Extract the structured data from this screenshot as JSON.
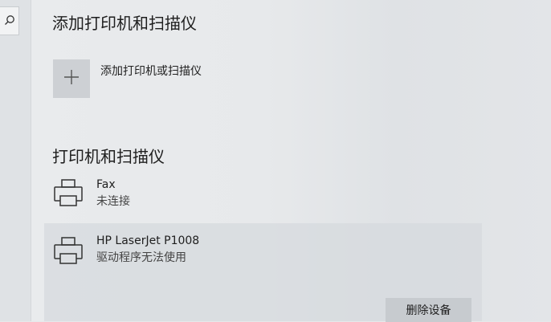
{
  "sidebar": {
    "search_icon": "search-icon"
  },
  "add_section": {
    "title": "添加打印机和扫描仪",
    "add_button_label": "添加打印机或扫描仪",
    "add_icon": "plus-icon"
  },
  "devices_section": {
    "title": "打印机和扫描仪",
    "devices": [
      {
        "name": "Fax",
        "status": "未连接",
        "icon": "printer-icon"
      },
      {
        "name": "HP LaserJet P1008",
        "status": "驱动程序无法使用",
        "icon": "printer-icon"
      }
    ],
    "remove_button_label": "删除设备"
  }
}
